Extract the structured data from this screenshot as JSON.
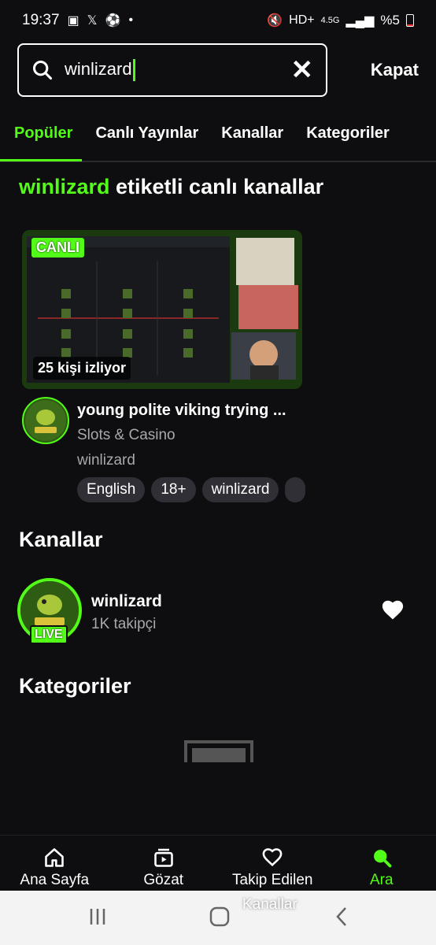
{
  "status_bar": {
    "time": "19:37",
    "battery": "%5",
    "network": "4.5G",
    "icons": [
      "image-icon",
      "x-icon",
      "football-icon",
      "dot-icon",
      "mute-icon",
      "hd-plus-icon",
      "signal-icon",
      "battery-icon"
    ]
  },
  "search": {
    "value": "winlizard",
    "clear_icon": "close-icon",
    "close_label": "Kapat"
  },
  "tabs": [
    {
      "label": "Popüler",
      "active": true
    },
    {
      "label": "Canlı Yayınlar",
      "active": false
    },
    {
      "label": "Kanallar",
      "active": false
    },
    {
      "label": "Kategoriler",
      "active": false
    }
  ],
  "results_heading": {
    "keyword": "winlizard",
    "suffix": " etiketli canlı kanallar"
  },
  "stream": {
    "live_badge": "CANLI",
    "viewers": "25 kişi izliyor",
    "title": "young polite viking trying ...",
    "category": "Slots & Casino",
    "channel": "winlizard",
    "tags": [
      "English",
      "18+",
      "winlizard"
    ]
  },
  "channels_section": {
    "title": "Kanallar",
    "items": [
      {
        "name": "winlizard",
        "followers": "1K takipçi",
        "live_badge": "LIVE"
      }
    ]
  },
  "categories_section": {
    "title": "Kategoriler"
  },
  "bottom_nav": [
    {
      "label": "Ana Sayfa",
      "icon": "home-icon",
      "active": false
    },
    {
      "label": "Gözat",
      "icon": "browse-icon",
      "active": false
    },
    {
      "label": "Takip Edilen",
      "icon": "heart-icon",
      "active": false
    },
    {
      "label": "Ara",
      "icon": "search-icon",
      "active": true
    }
  ],
  "overlay_text": "Kanallar",
  "colors": {
    "accent": "#53fc18",
    "background": "#0e0e10",
    "muted_text": "#a8a8ad",
    "tag_bg": "#2f2f35"
  }
}
